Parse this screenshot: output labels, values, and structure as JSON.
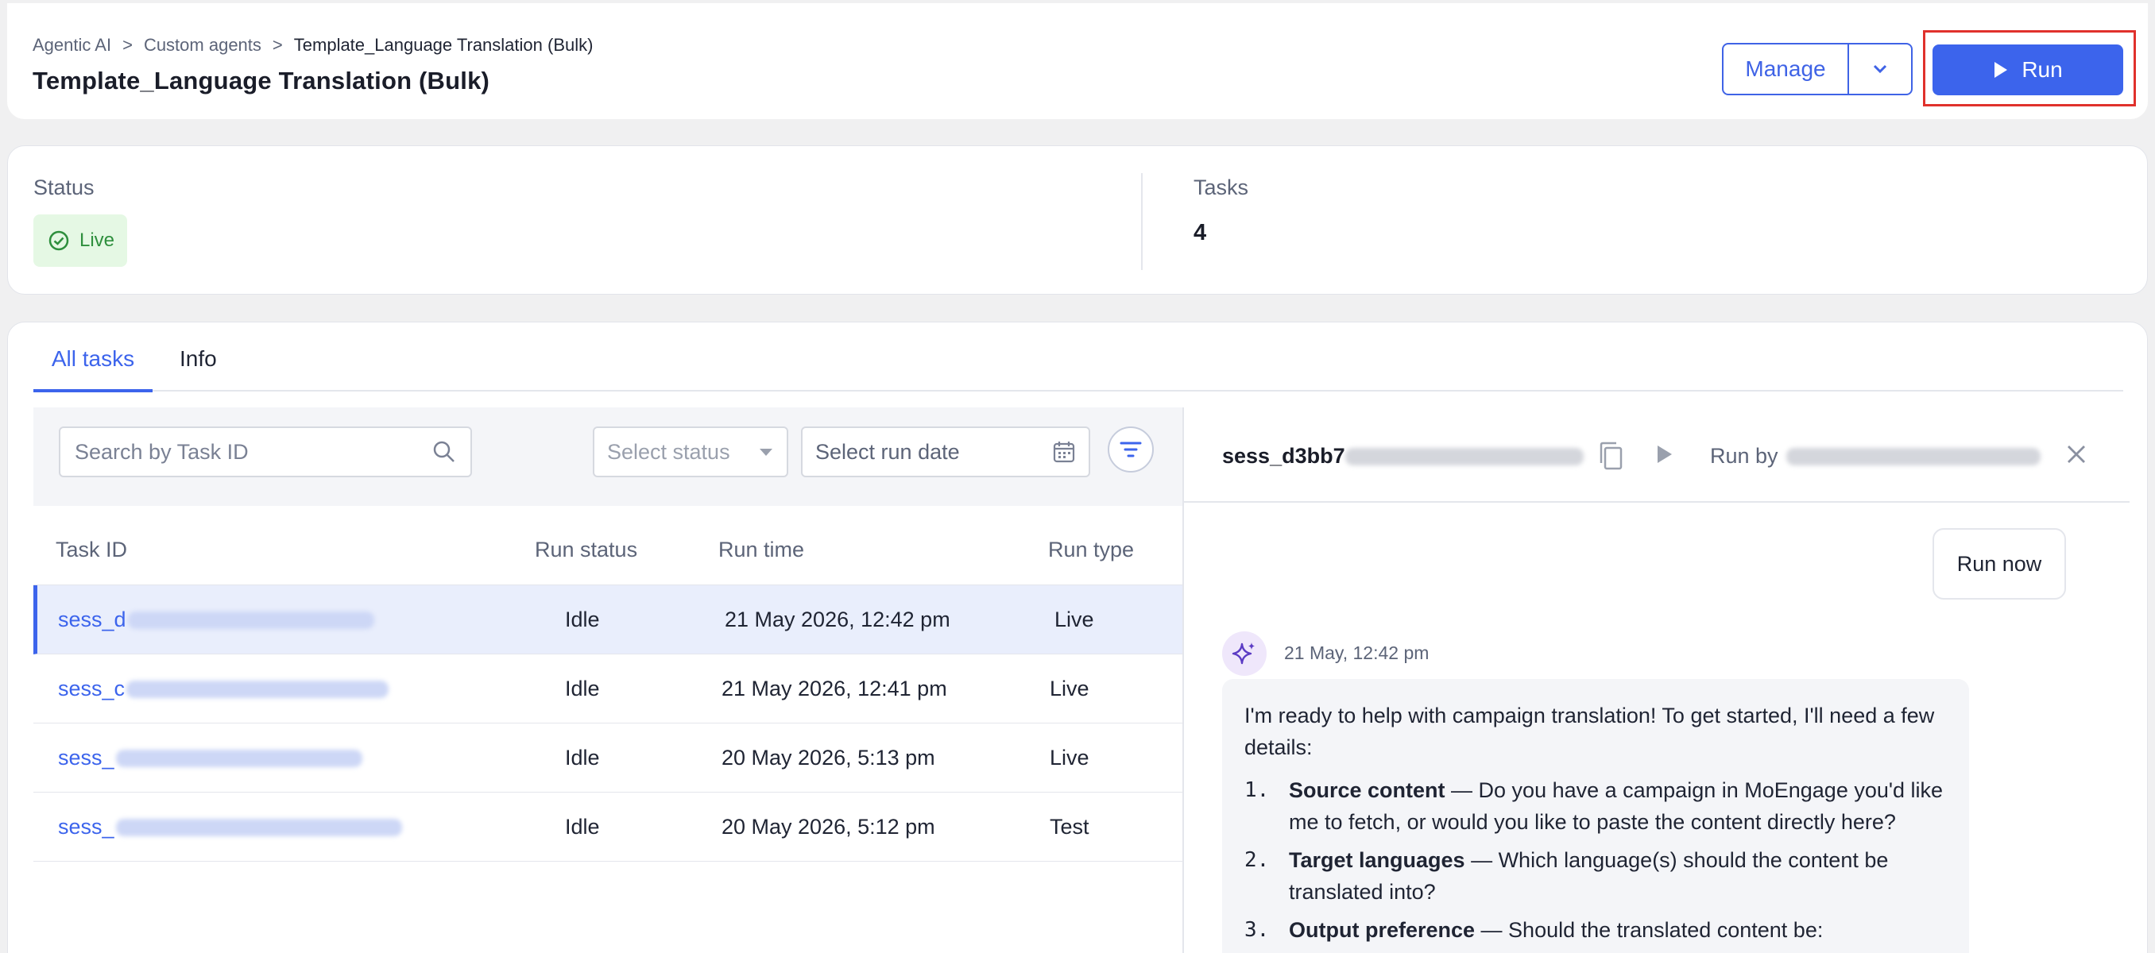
{
  "breadcrumb": [
    "Agentic AI",
    "Custom agents",
    "Template_Language Translation (Bulk)"
  ],
  "page_title": "Template_Language Translation (Bulk)",
  "header_actions": {
    "manage_label": "Manage",
    "run_label": "Run"
  },
  "status": {
    "label": "Status",
    "badge": "Live"
  },
  "tasks": {
    "label": "Tasks",
    "value": "4"
  },
  "tabs": [
    {
      "label": "All tasks"
    },
    {
      "label": "Info"
    }
  ],
  "filters": {
    "search_placeholder": "Search by Task ID",
    "status_placeholder": "Select status",
    "date_placeholder": "Select run date"
  },
  "table": {
    "columns": [
      "Task ID",
      "Run status",
      "Run time",
      "Run type"
    ],
    "rows": [
      {
        "task_id": "sess_d",
        "run_status": "Idle",
        "run_time": "21 May 2026, 12:42 pm",
        "run_type": "Live"
      },
      {
        "task_id": "sess_c",
        "run_status": "Idle",
        "run_time": "21 May 2026, 12:41 pm",
        "run_type": "Live"
      },
      {
        "task_id": "sess_",
        "run_status": "Idle",
        "run_time": "20 May 2026, 5:13 pm",
        "run_type": "Live"
      },
      {
        "task_id": "sess_",
        "run_status": "Idle",
        "run_time": "20 May 2026, 5:12 pm",
        "run_type": "Test"
      }
    ]
  },
  "detail": {
    "session_id": "sess_d3bb7",
    "run_by_label": "Run by",
    "user_message": "Run now",
    "message_time": "21 May, 12:42 pm",
    "message_intro": "I'm ready to help with campaign translation! To get started, I'll need a few details:",
    "items": [
      {
        "num": "1.",
        "title": "Source content",
        "text": " — Do you have a campaign in MoEngage you'd like me to fetch, or would you like to paste the content directly here?"
      },
      {
        "num": "2.",
        "title": "Target languages",
        "text": " — Which language(s) should the content be translated into?"
      },
      {
        "num": "3.",
        "title": "Output preference",
        "text": " — Should the translated content be:"
      }
    ]
  },
  "colors": {
    "accent": "#3c64ec",
    "live_green": "#2e8f3d",
    "highlight_red": "#e0312c"
  }
}
